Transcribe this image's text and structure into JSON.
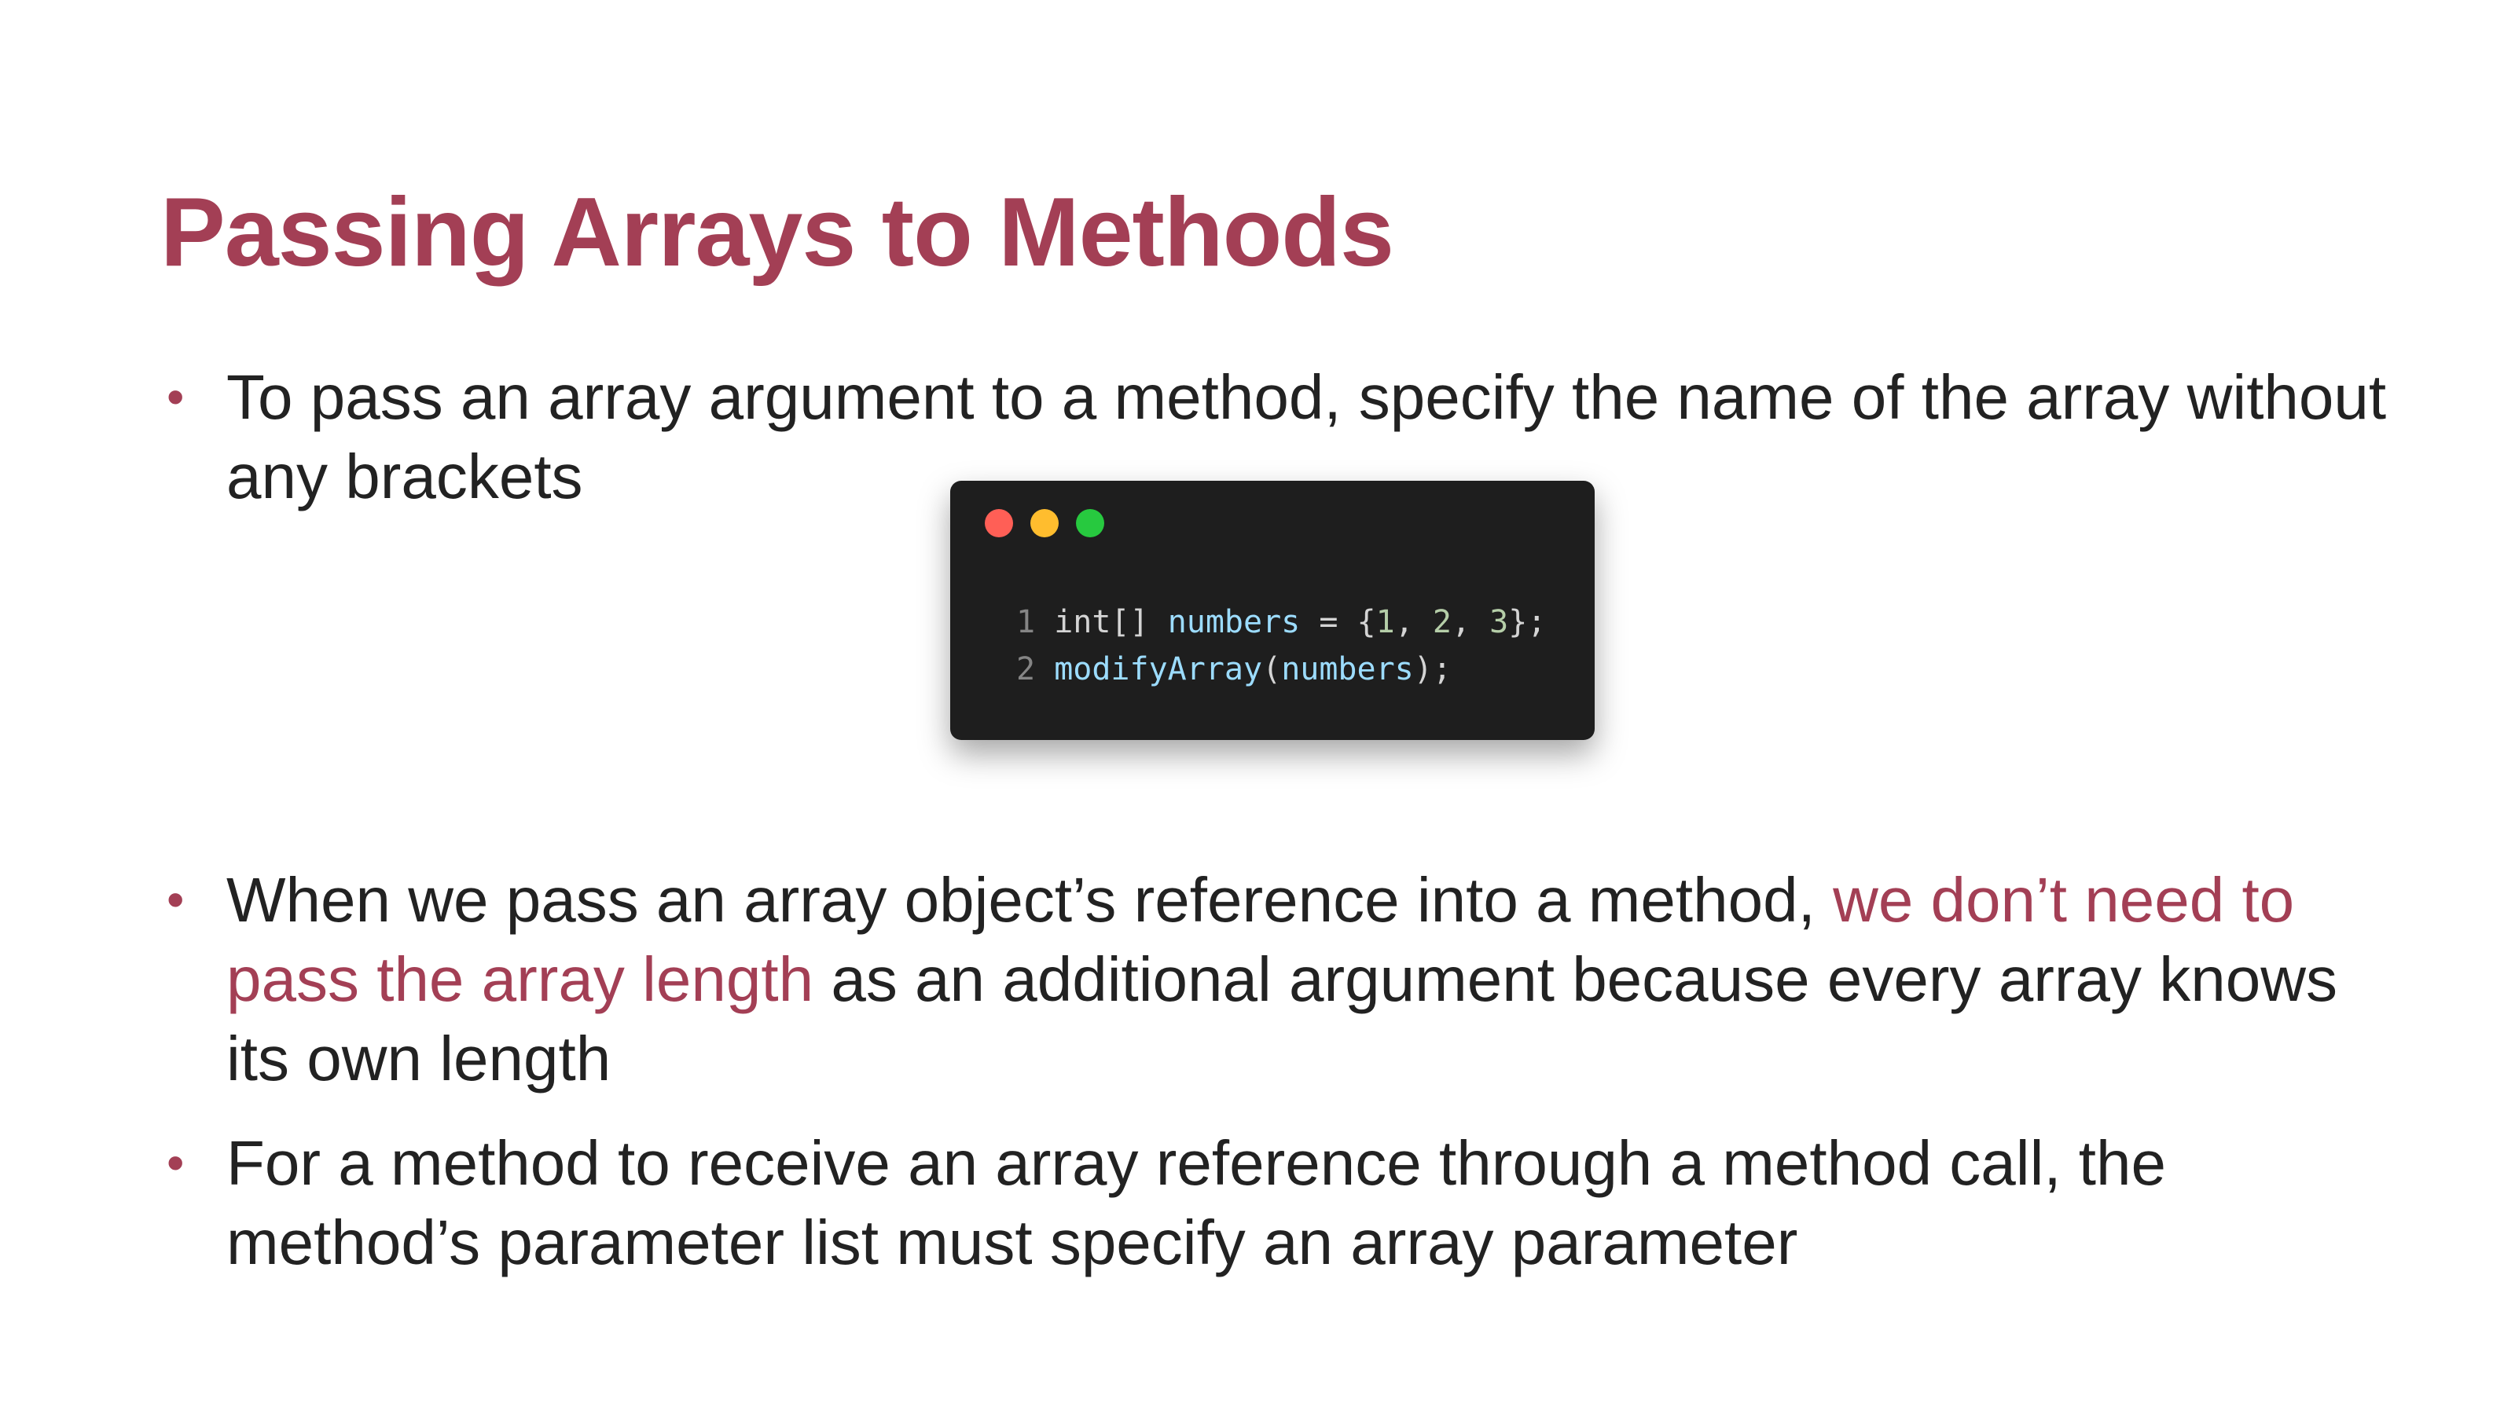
{
  "colors": {
    "title": "#a33f55",
    "text": "#222222",
    "highlight": "#a33f55",
    "bullet": "#a33f55",
    "code_background": "#1e1e1e",
    "code_plain": "#d4d4d4",
    "code_identifier": "#9cdcfe",
    "code_function": "#9cdcfe",
    "code_number": "#b5cea8",
    "code_line_number": "#858585",
    "window_close": "#ff5f56",
    "window_minimize": "#ffbd2e",
    "window_maximize": "#27c93f"
  },
  "slide": {
    "title": "Passing Arrays to Methods",
    "bullet_symbol": "•",
    "bullets": [
      {
        "text": "To pass an array argument to a method, specify the name of the array without any brackets"
      },
      {
        "text_before": "When we pass an array object’s reference into a method, ",
        "highlight": "we don’t need to pass the array length",
        "text_after": " as an additional argument because every array knows its own length"
      },
      {
        "text": "For a method to receive an array reference through a method call, the method’s parameter list must specify an array parameter"
      }
    ]
  },
  "code_window": {
    "window_controls": [
      "close-dot",
      "minimize-dot",
      "maximize-dot"
    ],
    "lines": [
      {
        "number": "1",
        "tokens": [
          {
            "text": "int[] ",
            "kind": "plain"
          },
          {
            "text": "numbers",
            "kind": "identifier"
          },
          {
            "text": " = {",
            "kind": "plain"
          },
          {
            "text": "1",
            "kind": "number"
          },
          {
            "text": ", ",
            "kind": "plain"
          },
          {
            "text": "2",
            "kind": "number"
          },
          {
            "text": ", ",
            "kind": "plain"
          },
          {
            "text": "3",
            "kind": "number"
          },
          {
            "text": "};",
            "kind": "plain"
          }
        ]
      },
      {
        "number": "2",
        "tokens": [
          {
            "text": "modifyArray",
            "kind": "function"
          },
          {
            "text": "(",
            "kind": "plain"
          },
          {
            "text": "numbers",
            "kind": "identifier"
          },
          {
            "text": ");",
            "kind": "plain"
          }
        ]
      }
    ]
  }
}
